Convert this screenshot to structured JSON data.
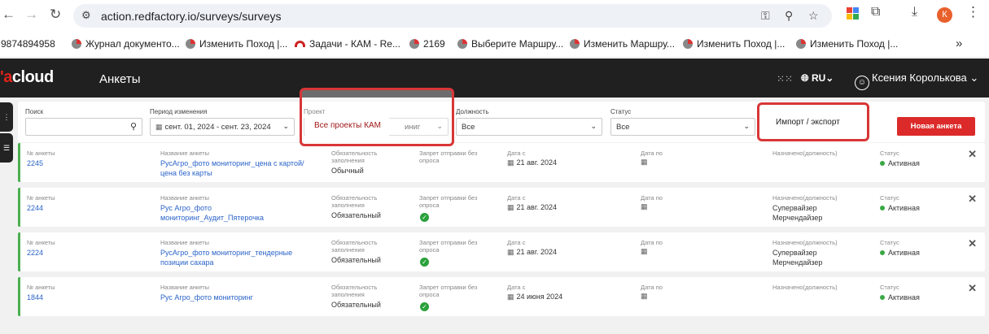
{
  "browser": {
    "url": "action.redfactory.io/surveys/surveys",
    "profile_initial": "К",
    "bookmarks": [
      "9874894958",
      "Журнал документо...",
      "Изменить Поход |...",
      "Задачи - КАМ - Re...",
      "2169",
      "Выберите Маршру...",
      "Изменить Маршру...",
      "Изменить Поход |...",
      "Изменить Поход |..."
    ],
    "more": "»"
  },
  "app": {
    "logo_prefix": "'a",
    "logo_rest": "cloud",
    "title": "Анкеты",
    "language": "RU",
    "user_name": "Ксения Королькова",
    "accent": "#dc2a2a"
  },
  "filters": {
    "search_label": "Поиск",
    "period_label": "Период изменения",
    "period_value": "сент. 01, 2024 - сент. 23, 2024",
    "project_label": "Проект",
    "project_value_partial": "иниг",
    "position_label": "Должность",
    "position_value": "Все",
    "status_label": "Статус",
    "status_value": "Все",
    "new_button": "Новая анкета"
  },
  "overlays": {
    "project_text": "Все проекты КАМ",
    "import_export": "Импорт / экспорт"
  },
  "columns": {
    "number": "№ анкеты",
    "name": "Название анкеты",
    "required": "Обязательность заполнения",
    "ban": "Запрет отправки без опроса",
    "date_from": "Дата с",
    "date_to": "Дата по",
    "assigned": "Назначено(должность)",
    "status": "Статус"
  },
  "rows": [
    {
      "number": "2245",
      "name1": "РусАгро_фото мониторинг_цена с картой/",
      "name2": "цена без карты",
      "required": "Обычный",
      "ban": false,
      "date_from": "21 авг. 2024",
      "assigned1": "",
      "assigned2": "",
      "status": "Активная"
    },
    {
      "number": "2244",
      "name1": "Рус Агро_фото",
      "name2": "мониторинг_Аудит_Пятерочка",
      "required": "Обязательный",
      "ban": true,
      "date_from": "21 авг. 2024",
      "assigned1": "Супервайзер",
      "assigned2": "Мерчендайзер",
      "status": "Активная"
    },
    {
      "number": "2224",
      "name1": "РусАгро_фото мониторинг_тендерные",
      "name2": "позиции сахара",
      "required": "Обязательный",
      "ban": true,
      "date_from": "21 авг. 2024",
      "assigned1": "Супервайзер",
      "assigned2": "Мерчендайзер",
      "status": "Активная"
    },
    {
      "number": "1844",
      "name1": "Рус Агро_фото мониторинг",
      "name2": "",
      "required": "Обязательный",
      "ban": true,
      "date_from": "24 июня 2024",
      "assigned1": "",
      "assigned2": "",
      "status": "Активная"
    }
  ]
}
